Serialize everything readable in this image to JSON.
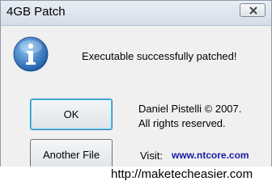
{
  "window": {
    "title": "4GB Patch",
    "close_label": "×"
  },
  "dialog": {
    "icon": "info-icon",
    "message": "Executable successfully patched!",
    "ok_label": "OK",
    "another_file_label": "Another File",
    "copyright_line1": "Daniel Pistelli © 2007.",
    "copyright_line2": "All rights reserved.",
    "visit_label": "Visit:",
    "visit_link": "www.ntcore.com"
  },
  "watermark": {
    "text": "http://maketecheasier.com"
  },
  "colors": {
    "link": "#1a1aa6",
    "icon_blue": "#2f6fb7",
    "ok_border": "#3c7fb1"
  }
}
